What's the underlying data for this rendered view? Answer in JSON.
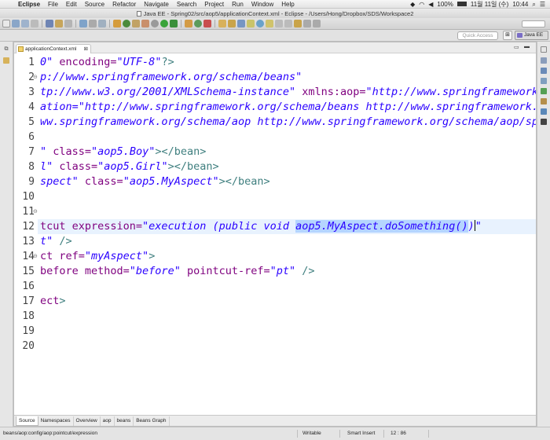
{
  "menubar": {
    "apple": "",
    "app": "Eclipse",
    "items": [
      "File",
      "Edit",
      "Source",
      "Refactor",
      "Navigate",
      "Search",
      "Project",
      "Run",
      "Window",
      "Help"
    ],
    "battery": "100%",
    "date": "11월 11일 (수)",
    "time": "10:44"
  },
  "window": {
    "title": "Java EE - Spring02/src/aop5/applicationContext.xml - Eclipse - /Users/Hong/Dropbox/SDS/Workspace2"
  },
  "quickbar": {
    "quick_access_placeholder": "Quick Access",
    "perspective": "Java EE"
  },
  "editor": {
    "tab_label": "applicationContext.xml",
    "tab_close": "⊠",
    "current_line": 12,
    "lines": [
      {
        "n": "1",
        "fold": "",
        "segs": [
          [
            "val",
            "0\""
          ],
          [
            "attr",
            " encoding="
          ],
          [
            "val",
            "\"UTF-8\""
          ],
          [
            "tag",
            "?>"
          ]
        ]
      },
      {
        "n": "2",
        "fold": "⊖",
        "segs": [
          [
            "val",
            "p://www.springframework.org/schema/beans\""
          ]
        ]
      },
      {
        "n": "3",
        "fold": "",
        "segs": [
          [
            "val",
            "tp://www.w3.org/2001/XMLSchema-instance\""
          ],
          [
            "attr",
            " xmlns:aop="
          ],
          [
            "val",
            "\"http://www.springframework."
          ]
        ]
      },
      {
        "n": "4",
        "fold": "",
        "segs": [
          [
            "val",
            "ation="
          ],
          [
            "val",
            "\"http://www.springframework.org/schema/beans http://www.springframework.o"
          ]
        ]
      },
      {
        "n": "5",
        "fold": "",
        "segs": [
          [
            "val",
            "ww.springframework.org/schema/aop http://www.springframework.org/schema/aop/spri"
          ]
        ]
      },
      {
        "n": "6",
        "fold": "",
        "segs": []
      },
      {
        "n": "7",
        "fold": "",
        "segs": [
          [
            "val",
            "\""
          ],
          [
            "attr",
            " class="
          ],
          [
            "val",
            "\"aop5.Boy\""
          ],
          [
            "tag",
            "></bean>"
          ]
        ]
      },
      {
        "n": "8",
        "fold": "",
        "segs": [
          [
            "val",
            "l\""
          ],
          [
            "attr",
            " class="
          ],
          [
            "val",
            "\"aop5.Girl\""
          ],
          [
            "tag",
            "></bean>"
          ]
        ]
      },
      {
        "n": "9",
        "fold": "",
        "segs": [
          [
            "val",
            "spect\""
          ],
          [
            "attr",
            " class="
          ],
          [
            "val",
            "\"aop5.MyAspect\""
          ],
          [
            "tag",
            "></bean>"
          ]
        ]
      },
      {
        "n": "10",
        "fold": "",
        "segs": []
      },
      {
        "n": "11",
        "fold": "⊖",
        "segs": []
      },
      {
        "n": "12",
        "fold": "",
        "segs": [
          [
            "attr",
            "tcut expression="
          ],
          [
            "val",
            "\"execution (public void "
          ],
          [
            "sel",
            "aop5.MyAspect.doSomething()"
          ],
          [
            "val",
            ")"
          ],
          [
            "caret",
            ""
          ],
          [
            "val",
            "\""
          ]
        ]
      },
      {
        "n": "13",
        "fold": "",
        "segs": [
          [
            "val",
            "t\""
          ],
          [
            "tag",
            " />"
          ]
        ]
      },
      {
        "n": "14",
        "fold": "⊖",
        "segs": [
          [
            "attr",
            "ct ref="
          ],
          [
            "val",
            "\"myAspect\""
          ],
          [
            "tag",
            ">"
          ]
        ]
      },
      {
        "n": "15",
        "fold": "",
        "segs": [
          [
            "attr",
            "before method="
          ],
          [
            "val",
            "\"before\""
          ],
          [
            "attr",
            " pointcut-ref="
          ],
          [
            "val",
            "\"pt\""
          ],
          [
            "tag",
            " />"
          ]
        ]
      },
      {
        "n": "16",
        "fold": "",
        "segs": []
      },
      {
        "n": "17",
        "fold": "",
        "segs": [
          [
            "attr",
            "ect"
          ],
          [
            "tag",
            ">"
          ]
        ]
      },
      {
        "n": "18",
        "fold": "",
        "segs": []
      },
      {
        "n": "19",
        "fold": "",
        "segs": []
      },
      {
        "n": "20",
        "fold": "",
        "segs": []
      }
    ],
    "bottom_tabs": [
      "Source",
      "Namespaces",
      "Overview",
      "aop",
      "beans",
      "Beans Graph"
    ],
    "active_bottom_tab": "Source"
  },
  "statusbar": {
    "path": "beans/aop:config/aop:pointcut/expression",
    "writable": "Writable",
    "insert_mode": "Smart Insert",
    "position": "12 : 86"
  },
  "colors": {
    "attr": "#7f007f",
    "value": "#2a00ff",
    "tag": "#3f7f7f",
    "current_line": "#e8f2fe",
    "selection": "#b5d5ff"
  }
}
